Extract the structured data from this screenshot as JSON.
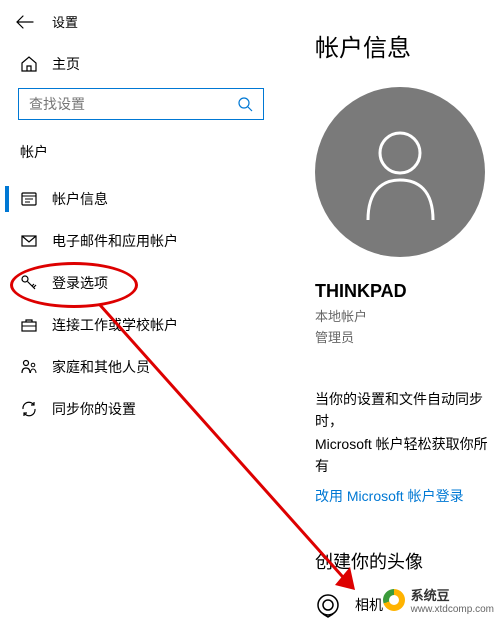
{
  "header": {
    "title": "设置"
  },
  "home": {
    "label": "主页"
  },
  "search": {
    "placeholder": "查找设置"
  },
  "section": {
    "label": "帐户"
  },
  "nav": {
    "items": [
      {
        "label": "帐户信息"
      },
      {
        "label": "电子邮件和应用帐户"
      },
      {
        "label": "登录选项"
      },
      {
        "label": "连接工作或学校帐户"
      },
      {
        "label": "家庭和其他人员"
      },
      {
        "label": "同步你的设置"
      }
    ]
  },
  "page": {
    "title": "帐户信息",
    "account_name": "THINKPAD",
    "account_type1": "本地帐户",
    "account_type2": "管理员",
    "sync_line1": "当你的设置和文件自动同步时，",
    "sync_line2": "Microsoft 帐户轻松获取你所有",
    "link": "改用 Microsoft 帐户登录",
    "subsection": "创建你的头像",
    "camera_label": "相机"
  },
  "watermark": {
    "name": "系统豆",
    "url": "www.xtdcomp.com"
  }
}
